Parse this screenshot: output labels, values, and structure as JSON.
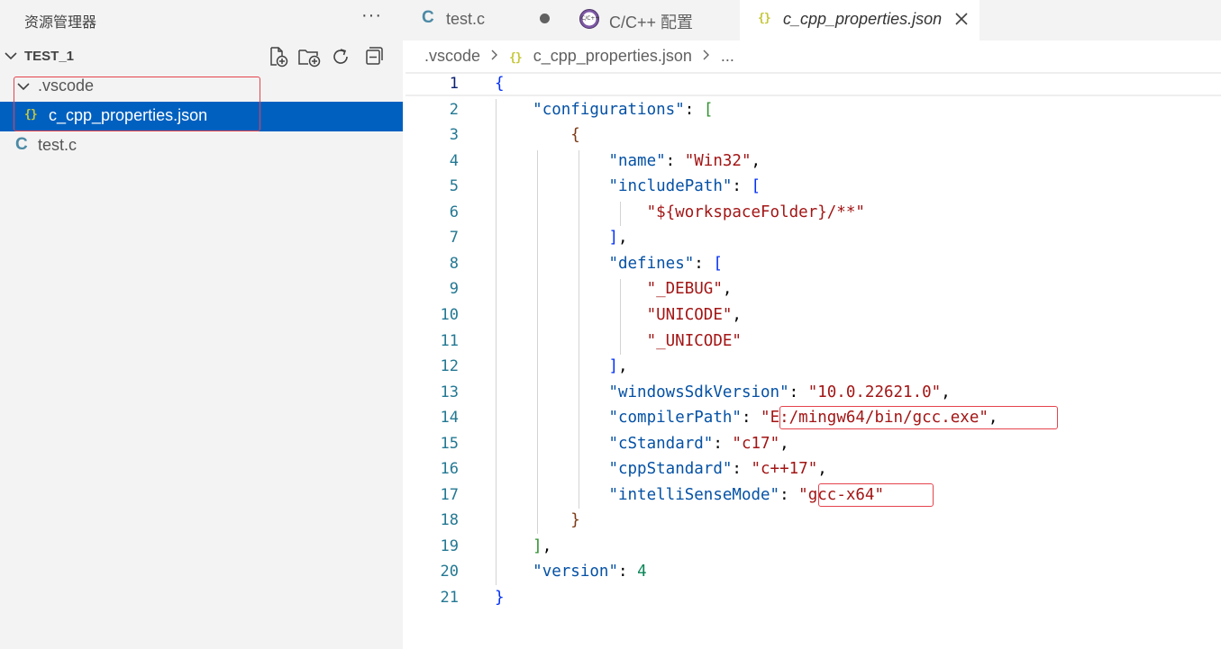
{
  "sidebar": {
    "title": "资源管理器",
    "more_label": "···",
    "workspace": "TEST_1",
    "actions": [
      "new-file-icon",
      "new-folder-icon",
      "refresh-icon",
      "collapse-all-icon"
    ],
    "tree": {
      "folder": ".vscode",
      "json_file": "c_cpp_properties.json",
      "json_icon": "{}",
      "c_file": "test.c",
      "c_icon": "C"
    }
  },
  "tabs": [
    {
      "icon": "C",
      "label": "test.c",
      "modified": true
    },
    {
      "icon": "C/C++",
      "label": "C/C++ 配置"
    },
    {
      "icon": "{}",
      "label": "c_cpp_properties.json",
      "active": true
    }
  ],
  "breadcrumb": {
    "folder": ".vscode",
    "sep": ">",
    "file_icon": "{}",
    "file": "c_cpp_properties.json",
    "more": "..."
  },
  "editor": {
    "active_line": 1,
    "line_numbers": [
      "1",
      "2",
      "3",
      "4",
      "5",
      "6",
      "7",
      "8",
      "9",
      "10",
      "11",
      "12",
      "13",
      "14",
      "15",
      "16",
      "17",
      "18",
      "19",
      "20",
      "21"
    ],
    "lines": [
      [
        {
          "t": "{",
          "c": "b1"
        }
      ],
      [
        {
          "t": "    "
        },
        {
          "t": "\"configurations\"",
          "c": "k"
        },
        {
          "t": ": "
        },
        {
          "t": "[",
          "c": "b2"
        }
      ],
      [
        {
          "t": "        "
        },
        {
          "t": "{",
          "c": "b3"
        }
      ],
      [
        {
          "t": "            "
        },
        {
          "t": "\"name\"",
          "c": "k"
        },
        {
          "t": ": "
        },
        {
          "t": "\"Win32\"",
          "c": "s"
        },
        {
          "t": ","
        }
      ],
      [
        {
          "t": "            "
        },
        {
          "t": "\"includePath\"",
          "c": "k"
        },
        {
          "t": ": "
        },
        {
          "t": "[",
          "c": "b1"
        }
      ],
      [
        {
          "t": "                "
        },
        {
          "t": "\"${workspaceFolder}/**\"",
          "c": "s"
        }
      ],
      [
        {
          "t": "            "
        },
        {
          "t": "]",
          "c": "b1"
        },
        {
          "t": ","
        }
      ],
      [
        {
          "t": "            "
        },
        {
          "t": "\"defines\"",
          "c": "k"
        },
        {
          "t": ": "
        },
        {
          "t": "[",
          "c": "b1"
        }
      ],
      [
        {
          "t": "                "
        },
        {
          "t": "\"_DEBUG\"",
          "c": "s"
        },
        {
          "t": ","
        }
      ],
      [
        {
          "t": "                "
        },
        {
          "t": "\"UNICODE\"",
          "c": "s"
        },
        {
          "t": ","
        }
      ],
      [
        {
          "t": "                "
        },
        {
          "t": "\"_UNICODE\"",
          "c": "s"
        }
      ],
      [
        {
          "t": "            "
        },
        {
          "t": "]",
          "c": "b1"
        },
        {
          "t": ","
        }
      ],
      [
        {
          "t": "            "
        },
        {
          "t": "\"windowsSdkVersion\"",
          "c": "k"
        },
        {
          "t": ": "
        },
        {
          "t": "\"10.0.22621.0\"",
          "c": "s"
        },
        {
          "t": ","
        }
      ],
      [
        {
          "t": "            "
        },
        {
          "t": "\"compilerPath\"",
          "c": "k"
        },
        {
          "t": ": "
        },
        {
          "t": "\"E:/mingw64/bin/gcc.exe\"",
          "c": "s"
        },
        {
          "t": ","
        }
      ],
      [
        {
          "t": "            "
        },
        {
          "t": "\"cStandard\"",
          "c": "k"
        },
        {
          "t": ": "
        },
        {
          "t": "\"c17\"",
          "c": "s"
        },
        {
          "t": ","
        }
      ],
      [
        {
          "t": "            "
        },
        {
          "t": "\"cppStandard\"",
          "c": "k"
        },
        {
          "t": ": "
        },
        {
          "t": "\"c++17\"",
          "c": "s"
        },
        {
          "t": ","
        }
      ],
      [
        {
          "t": "            "
        },
        {
          "t": "\"intelliSenseMode\"",
          "c": "k"
        },
        {
          "t": ": "
        },
        {
          "t": "\"gcc-x64\"",
          "c": "s"
        }
      ],
      [
        {
          "t": "        "
        },
        {
          "t": "}",
          "c": "b3"
        }
      ],
      [
        {
          "t": "    "
        },
        {
          "t": "]",
          "c": "b2"
        },
        {
          "t": ","
        }
      ],
      [
        {
          "t": "    "
        },
        {
          "t": "\"version\"",
          "c": "k"
        },
        {
          "t": ": "
        },
        {
          "t": "4",
          "c": "n"
        }
      ],
      [
        {
          "t": "}",
          "c": "b1"
        }
      ]
    ]
  },
  "colors": {
    "selection": "#0060c0",
    "highlight_box": "#e5434d",
    "json_key": "#0451a5",
    "json_string": "#a31515",
    "json_number": "#098658"
  }
}
